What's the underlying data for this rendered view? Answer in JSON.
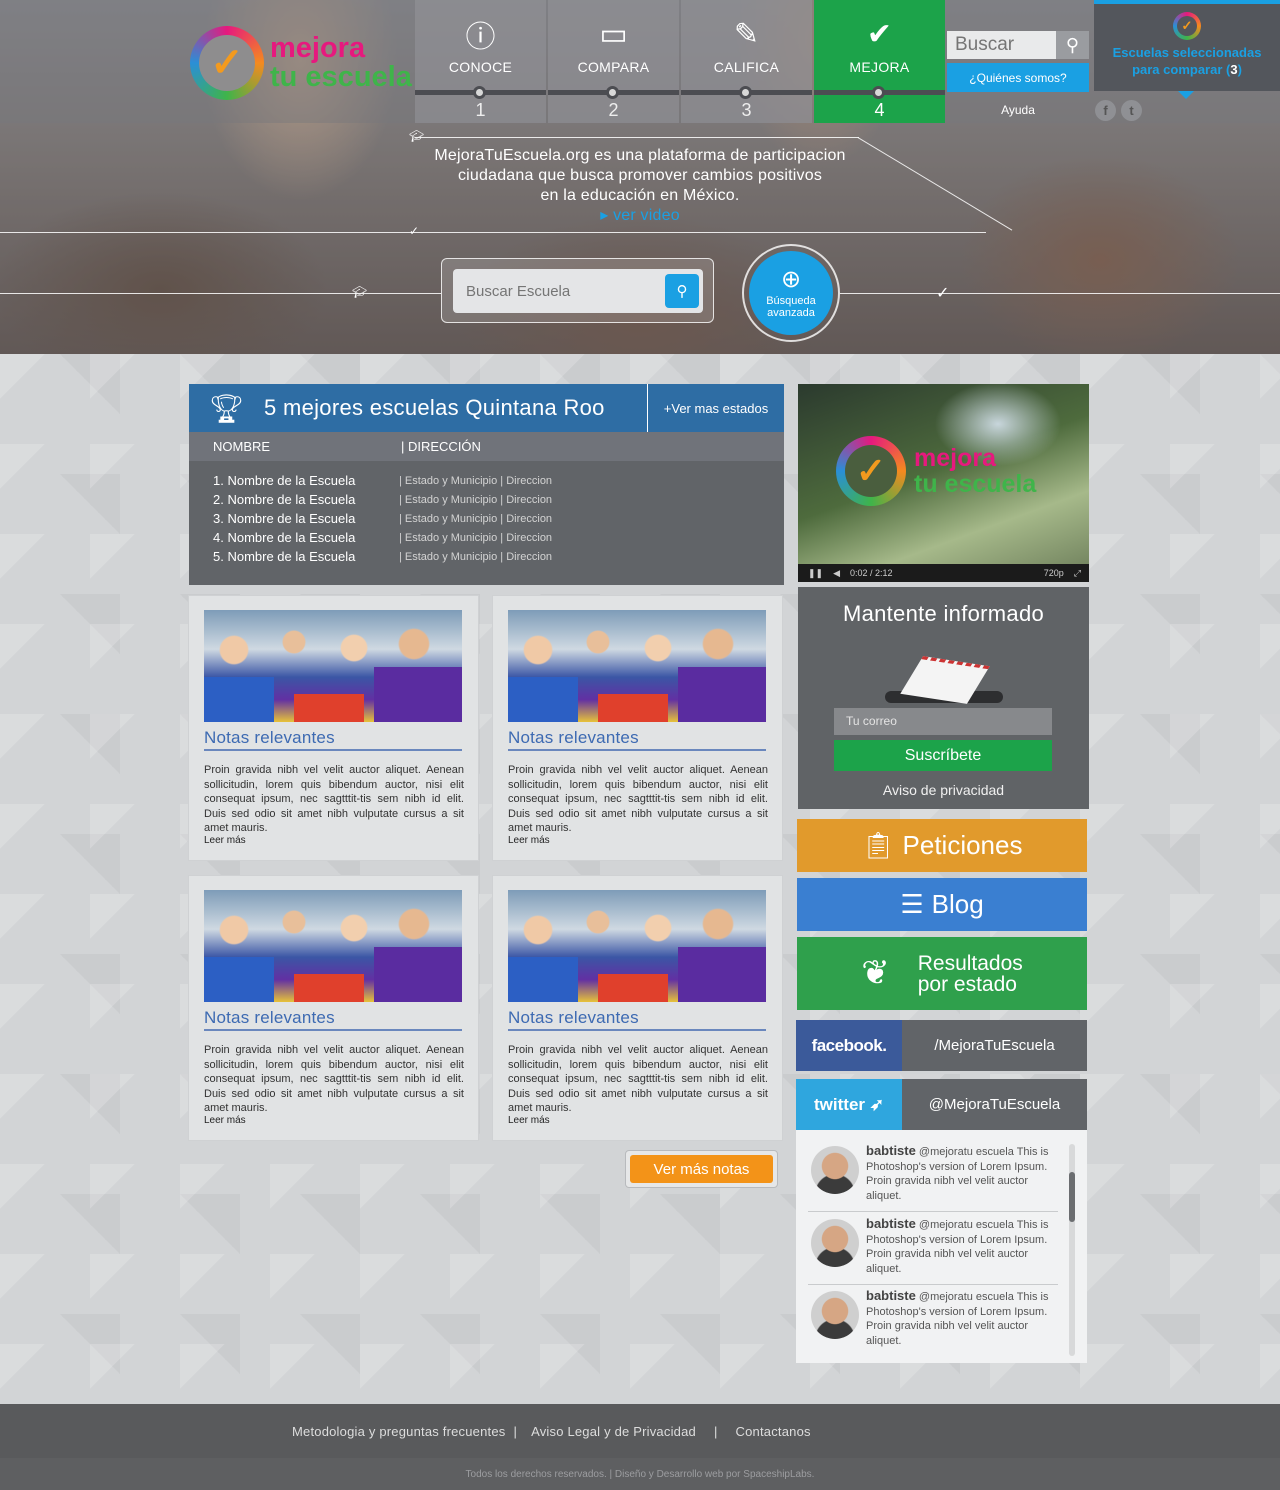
{
  "logo": {
    "line1": "mejora",
    "line2": "tu escuela"
  },
  "nav": [
    {
      "label": "CONOCE",
      "num": "1",
      "icon": "info-icon",
      "glyph": "ⓘ"
    },
    {
      "label": "COMPARA",
      "num": "2",
      "icon": "ruler-icon",
      "glyph": "▭"
    },
    {
      "label": "CALIFICA",
      "num": "3",
      "icon": "pencil-icon",
      "glyph": "✎"
    },
    {
      "label": "MEJORA",
      "num": "4",
      "icon": "check-circle-icon",
      "glyph": "✔"
    }
  ],
  "top_search": {
    "placeholder": "Buscar"
  },
  "quienes": "¿Quiénes somos?",
  "ayuda": "Ayuda",
  "compare": {
    "line1": "Escuelas seleccionadas",
    "line2": "para comparar (",
    "count": "3",
    "close": ")"
  },
  "social_top": [
    "f",
    "t"
  ],
  "tagline": {
    "line1": "MejoraTuEscuela.org es una plataforma de participacion",
    "line2": "ciudadana que busca promover cambios positivos",
    "line3": "en la educación en México.",
    "video": "ver video"
  },
  "main_search": {
    "placeholder": "Buscar Escuela"
  },
  "advanced": {
    "line1": "Búsqueda",
    "line2": "avanzada"
  },
  "top5": {
    "title": "5 mejores escuelas Quintana Roo",
    "more": "+Ver  mas estados",
    "col_name": "NOMBRE",
    "col_dir": "| DIRECCIÓN",
    "rows": [
      {
        "name": "1. Nombre de la Escuela",
        "dir": "| Estado y Municipio | Direccion"
      },
      {
        "name": "2. Nombre de la Escuela",
        "dir": "| Estado y Municipio | Direccion"
      },
      {
        "name": "3. Nombre de la Escuela",
        "dir": "| Estado y Municipio | Direccion"
      },
      {
        "name": "4. Nombre de la Escuela",
        "dir": "| Estado y Municipio | Direccion"
      },
      {
        "name": "5. Nombre de la Escuela",
        "dir": "| Estado y Municipio | Direccion"
      }
    ]
  },
  "notes": [
    {
      "title": "Notas relevantes",
      "text": "Proin gravida nibh vel velit auctor aliquet. Aenean sollicitudin, lorem quis bibendum auctor, nisi elit consequat ipsum, nec sagtttit-tis sem nibh id elit. Duis sed odio sit amet nibh vulputate cursus a sit amet mauris.",
      "more": "Leer más"
    },
    {
      "title": "Notas relevantes",
      "text": "Proin gravida nibh vel velit auctor aliquet. Aenean sollicitudin, lorem quis bibendum auctor, nisi elit consequat ipsum, nec sagtttit-tis sem nibh id elit. Duis sed odio sit amet nibh vulputate cursus a sit amet mauris.",
      "more": "Leer más"
    },
    {
      "title": "Notas relevantes",
      "text": "Proin gravida nibh vel velit auctor aliquet. Aenean sollicitudin, lorem quis bibendum auctor, nisi elit consequat ipsum, nec sagtttit-tis sem nibh id elit. Duis sed odio sit amet nibh vulputate cursus a sit amet mauris.",
      "more": "Leer más"
    },
    {
      "title": "Notas relevantes",
      "text": "Proin gravida nibh vel velit auctor aliquet. Aenean sollicitudin, lorem quis bibendum auctor, nisi elit consequat ipsum, nec sagtttit-tis sem nibh id elit. Duis sed odio sit amet nibh vulputate cursus a sit amet mauris.",
      "more": "Leer más"
    }
  ],
  "ver_mas": "Ver más notas",
  "video": {
    "logo1": "mejora",
    "logo2": "tu escuela",
    "time": "0:02 / 2:12",
    "quality": "720p"
  },
  "newsletter": {
    "title": "Mantente informado",
    "placeholder": "Tu correo",
    "button": "Suscríbete",
    "privacy": "Aviso de privacidad"
  },
  "tiles": {
    "peticiones": "Peticiones",
    "blog": "Blog",
    "resultados1": "Resultados",
    "resultados2": "por estado"
  },
  "facebook": {
    "brand": "facebook.",
    "handle": "/MejoraTuEscuela"
  },
  "twitter": {
    "brand": "twitter",
    "handle": "@MejoraTuEscuela"
  },
  "tweets": [
    {
      "user": "babtiste",
      "text": " @mejoratu escuela This is Photoshop's version  of Lorem Ipsum. Proin gravida nibh vel velit auctor aliquet."
    },
    {
      "user": "babtiste",
      "text": " @mejoratu escuela This is Photoshop's version  of Lorem Ipsum. Proin gravida nibh vel velit auctor aliquet."
    },
    {
      "user": "babtiste",
      "text": " @mejoratu escuela This is Photoshop's version  of Lorem Ipsum. Proin gravida nibh vel velit auctor aliquet."
    }
  ],
  "footer": {
    "link1": "Metodologia y preguntas frecuentes",
    "link2": "Aviso Legal  y  de Privacidad",
    "link3": "Contactanos",
    "sep": "|"
  },
  "copyright": "Todos los derechos reservados. | Diseño y Desarrollo web por SpaceshipLabs.",
  "colors": {
    "blue": "#1aa0e3",
    "green": "#1ca34a",
    "orange": "#f39318",
    "header_blue": "#2e6da4"
  }
}
